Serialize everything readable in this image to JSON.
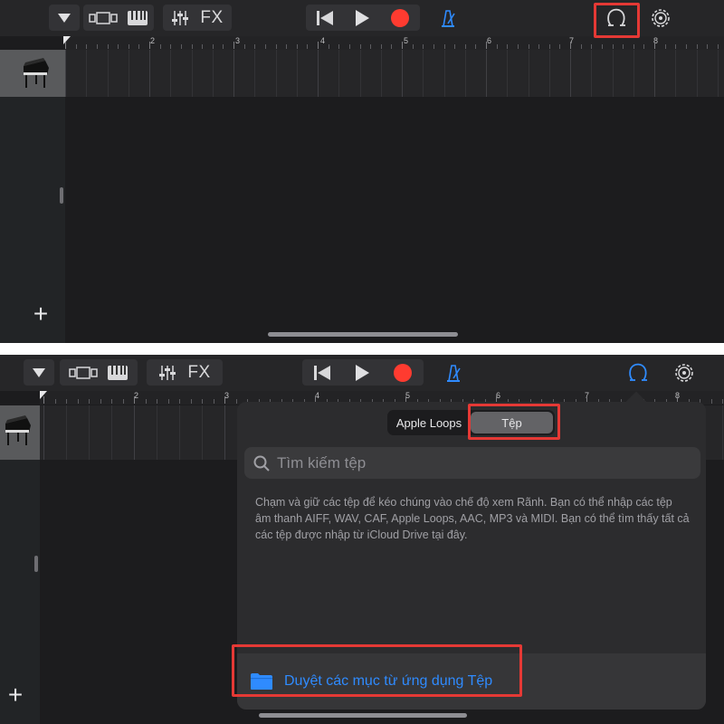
{
  "toolbar": {
    "fx_label": "FX",
    "accent": "#2f8bff",
    "record_color": "#ff3b30",
    "icons": [
      "dropdown-triangle-icon",
      "browser-view-icon",
      "keyboard-icon",
      "mixer-icon",
      "rewind-icon",
      "play-icon",
      "record-icon",
      "metronome-icon",
      "loop-browser-icon",
      "settings-gear-icon"
    ]
  },
  "ruler": {
    "bars": [
      "2",
      "3",
      "4",
      "5",
      "6",
      "7",
      "8"
    ]
  },
  "track": {
    "instrument": "grand-piano-icon",
    "add_label": "+"
  },
  "popover": {
    "segment_loops": "Apple Loops",
    "segment_files": "Tệp",
    "search_placeholder": "Tìm kiếm tệp",
    "description": "Chạm và giữ các tệp để kéo chúng vào chế độ xem Rãnh. Bạn có thể nhập các tệp âm thanh AIFF, WAV, CAF, Apple Loops, AAC, MP3 và MIDI. Bạn có thể tìm thấy tất cả các tệp được nhập từ iCloud Drive tại đây.",
    "browse_label": "Duyệt các mục từ ứng dụng Tệp"
  },
  "highlight_color": "#e53935"
}
